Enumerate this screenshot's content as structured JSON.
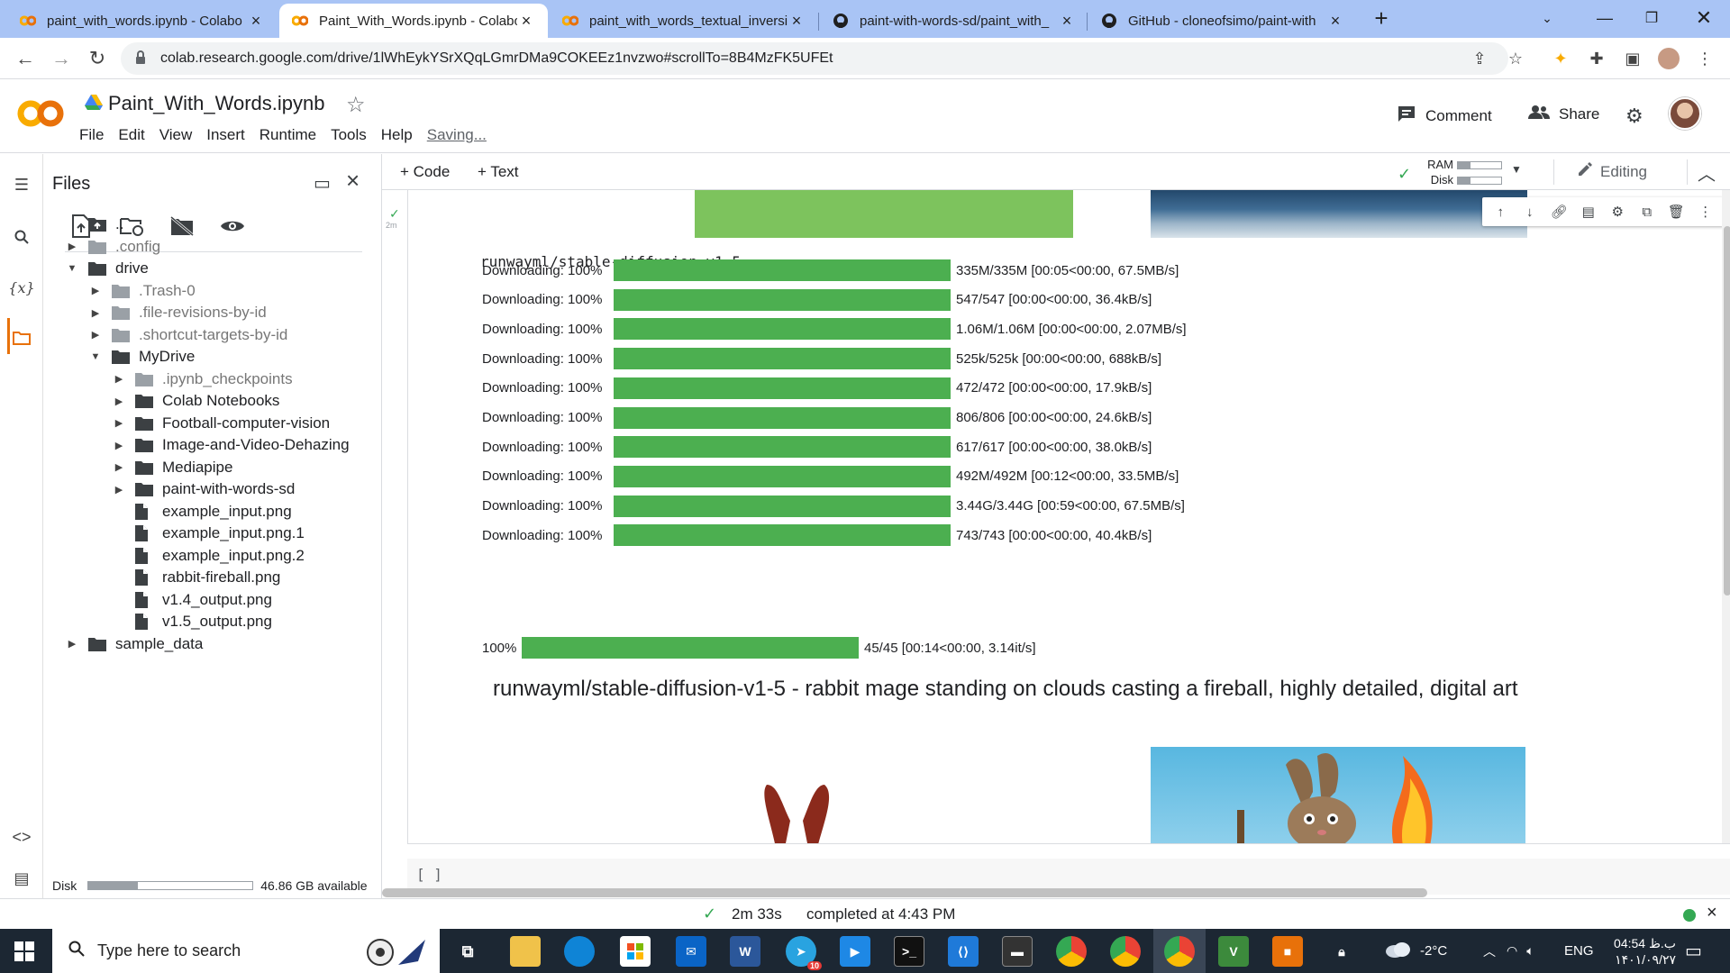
{
  "browser": {
    "tabs": [
      {
        "title": "paint_with_words.ipynb - Colabo",
        "active": false
      },
      {
        "title": "Paint_With_Words.ipynb - Colabo",
        "active": true
      },
      {
        "title": "paint_with_words_textual_inversio",
        "active": false
      },
      {
        "title": "paint-with-words-sd/paint_with_",
        "active": false
      },
      {
        "title": "GitHub - cloneofsimo/paint-with",
        "active": false
      }
    ],
    "url": "colab.research.google.com/drive/1lWhEykYSrXQqLGmrDMa9COKEEz1nvzwo#scrollTo=8B4MzFK5UFEt"
  },
  "colab": {
    "logo": "CO",
    "notebook_title": "Paint_With_Words.ipynb",
    "menu": [
      "File",
      "Edit",
      "View",
      "Insert",
      "Runtime",
      "Tools",
      "Help"
    ],
    "saving": "Saving...",
    "comment_label": "Comment",
    "share_label": "Share",
    "add_code": "+ Code",
    "add_text": "+ Text",
    "ram_label": "RAM",
    "disk_label": "Disk",
    "ram_usage": 0.3,
    "disk_usage": 0.3,
    "editing_label": "Editing"
  },
  "files_panel": {
    "title": "Files",
    "tree": [
      {
        "name": "..",
        "type": "up",
        "depth": 0,
        "caret": "none"
      },
      {
        "name": ".config",
        "type": "folder",
        "depth": 0,
        "caret": "closed",
        "dim": true
      },
      {
        "name": "drive",
        "type": "folder",
        "depth": 0,
        "caret": "open"
      },
      {
        "name": ".Trash-0",
        "type": "folder",
        "depth": 1,
        "caret": "closed",
        "dim": true
      },
      {
        "name": ".file-revisions-by-id",
        "type": "folder",
        "depth": 1,
        "caret": "closed",
        "dim": true
      },
      {
        "name": ".shortcut-targets-by-id",
        "type": "folder",
        "depth": 1,
        "caret": "closed",
        "dim": true
      },
      {
        "name": "MyDrive",
        "type": "folder",
        "depth": 1,
        "caret": "open"
      },
      {
        "name": ".ipynb_checkpoints",
        "type": "folder",
        "depth": 2,
        "caret": "closed",
        "dim": true
      },
      {
        "name": "Colab Notebooks",
        "type": "folder",
        "depth": 2,
        "caret": "closed"
      },
      {
        "name": "Football-computer-vision",
        "type": "folder",
        "depth": 2,
        "caret": "closed"
      },
      {
        "name": "Image-and-Video-Dehazing",
        "type": "folder",
        "depth": 2,
        "caret": "closed"
      },
      {
        "name": "Mediapipe",
        "type": "folder",
        "depth": 2,
        "caret": "closed"
      },
      {
        "name": "paint-with-words-sd",
        "type": "folder",
        "depth": 2,
        "caret": "closed"
      },
      {
        "name": "example_input.png",
        "type": "file",
        "depth": 2,
        "caret": "none"
      },
      {
        "name": "example_input.png.1",
        "type": "file",
        "depth": 2,
        "caret": "none"
      },
      {
        "name": "example_input.png.2",
        "type": "file",
        "depth": 2,
        "caret": "none"
      },
      {
        "name": "rabbit-fireball.png",
        "type": "file",
        "depth": 2,
        "caret": "none"
      },
      {
        "name": "v1.4_output.png",
        "type": "file",
        "depth": 2,
        "caret": "none"
      },
      {
        "name": "v1.5_output.png",
        "type": "file",
        "depth": 2,
        "caret": "none"
      },
      {
        "name": "sample_data",
        "type": "folder",
        "depth": 0,
        "caret": "closed"
      }
    ],
    "disk_label": "Disk",
    "disk_usage": 0.3,
    "disk_available": "46.86 GB available"
  },
  "cell": {
    "exec_time_short": "2m",
    "output_model": "runwayml/stable-diffusion-v1-5",
    "downloads": [
      {
        "label": "Downloading: 100%",
        "progress": 100,
        "detail": "335M/335M [00:05<00:00, 67.5MB/s]"
      },
      {
        "label": "Downloading: 100%",
        "progress": 100,
        "detail": "547/547 [00:00<00:00, 36.4kB/s]"
      },
      {
        "label": "Downloading: 100%",
        "progress": 100,
        "detail": "1.06M/1.06M [00:00<00:00, 2.07MB/s]"
      },
      {
        "label": "Downloading: 100%",
        "progress": 100,
        "detail": "525k/525k [00:00<00:00, 688kB/s]"
      },
      {
        "label": "Downloading: 100%",
        "progress": 100,
        "detail": "472/472 [00:00<00:00, 17.9kB/s]"
      },
      {
        "label": "Downloading: 100%",
        "progress": 100,
        "detail": "806/806 [00:00<00:00, 24.6kB/s]"
      },
      {
        "label": "Downloading: 100%",
        "progress": 100,
        "detail": "617/617 [00:00<00:00, 38.0kB/s]"
      },
      {
        "label": "Downloading: 100%",
        "progress": 100,
        "detail": "492M/492M [00:12<00:00, 33.5MB/s]"
      },
      {
        "label": "Downloading: 100%",
        "progress": 100,
        "detail": "3.44G/3.44G [00:59<00:00, 67.5MB/s]"
      },
      {
        "label": "Downloading: 100%",
        "progress": 100,
        "detail": "743/743 [00:00<00:00, 40.4kB/s]"
      }
    ],
    "final_progress": {
      "label": "100%",
      "progress": 100,
      "detail": "45/45 [00:14<00:00, 3.14it/s]"
    },
    "prompt_title": "runwayml/stable-diffusion-v1-5 - rabbit mage standing on clouds casting a fireball, highly detailed, digital art",
    "next_cell": "[ ]"
  },
  "status": {
    "elapsed": "2m 33s",
    "completed": "completed at 4:43 PM"
  },
  "taskbar": {
    "search_placeholder": "Type here to search",
    "telegram_badge": "10",
    "weather": "-2°C",
    "lang": "ENG",
    "time": "04:54 ب.ظ",
    "date": "۱۴۰۱/۰۹/۲۷"
  },
  "colors": {
    "progress_fill": "#4caf50",
    "colab_orange": "#e8710a",
    "colab_yellow": "#f9ab00",
    "tab_strip": "#a9c4f5"
  }
}
